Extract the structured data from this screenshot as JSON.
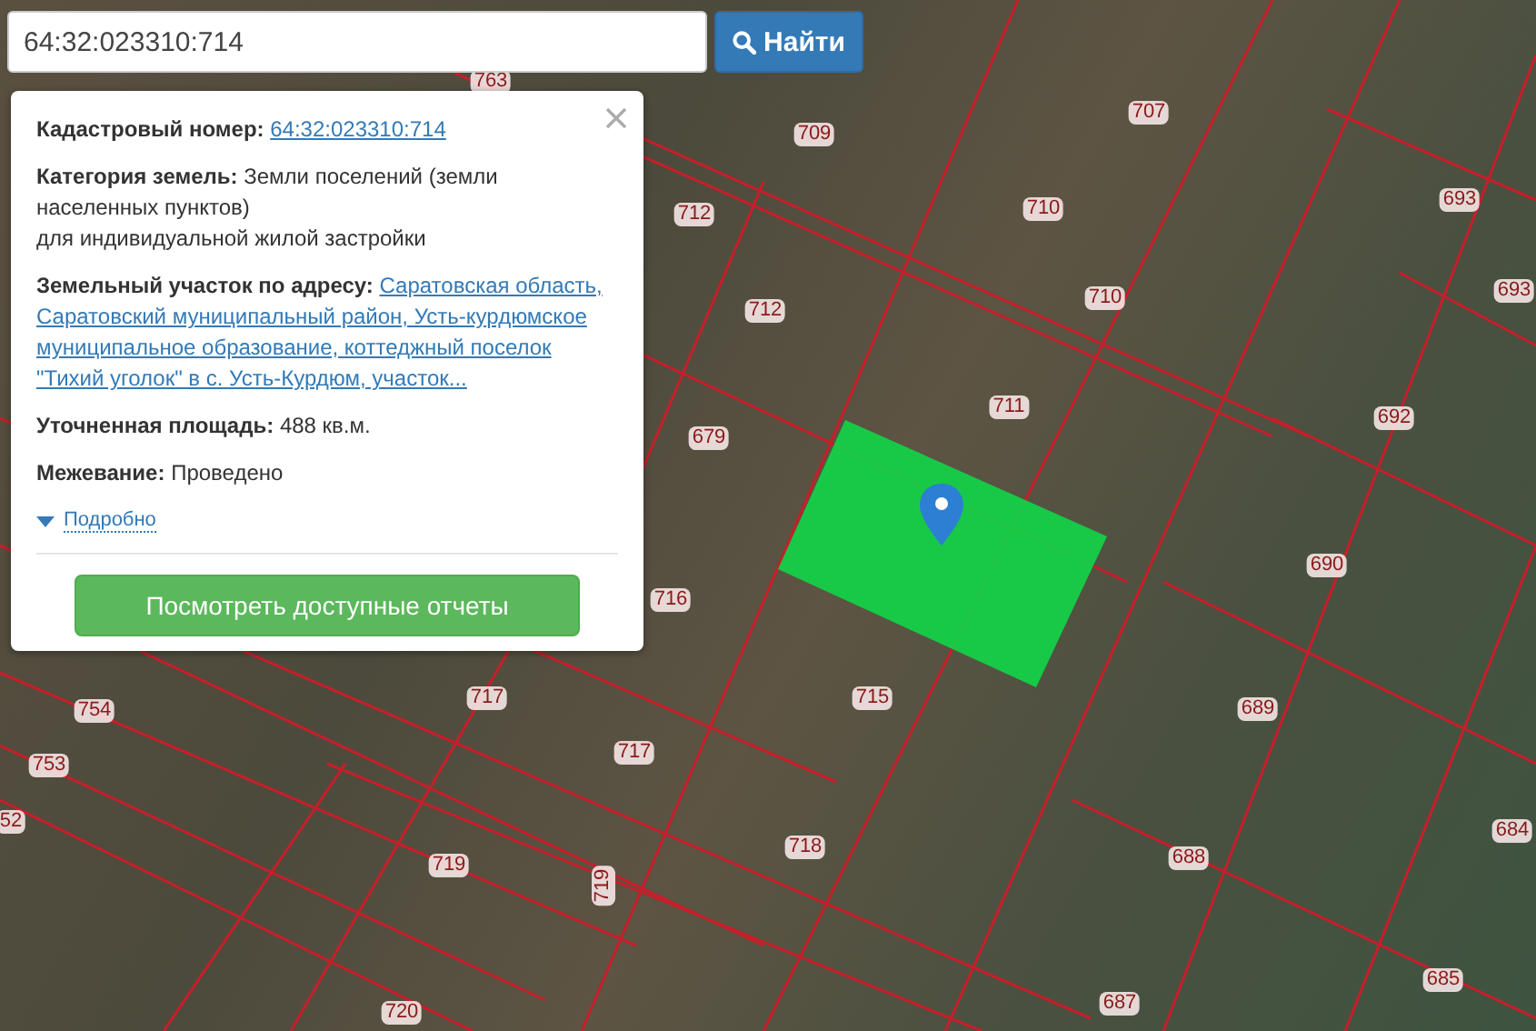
{
  "search": {
    "value": "64:32:023310:714",
    "button": "Найти"
  },
  "popup": {
    "rows": [
      {
        "label": "Кадастровый номер:",
        "value": "64:32:023310:714",
        "kind": "link"
      },
      {
        "label": "Категория земель:",
        "value": "Земли поселений (земли населенных пунктов)",
        "note": "для индивидуальной жилой застройки",
        "kind": "text"
      },
      {
        "label": "Земельный участок по адресу:",
        "value": "Саратовская область, Саратовский муниципальный район, Усть-курдюмское муниципальное образование, коттеджный поселок \"Тихий уголок\" в с. Усть-Курдюм, участок...",
        "kind": "link"
      },
      {
        "label": "Уточненная площадь:",
        "value": "488 кв.м.",
        "kind": "text"
      },
      {
        "label": "Межевание:",
        "value": "Проведено",
        "kind": "text"
      }
    ],
    "details": {
      "label": "Подробно",
      "expanded": false
    },
    "button": "Посмотреть доступные отчеты"
  },
  "map": {
    "parcel_labels": [
      "763",
      "709",
      "707",
      "712",
      "712",
      "710",
      "710",
      "693",
      "693",
      "711",
      "679",
      "692",
      "690",
      "716",
      "715",
      "689",
      "754",
      "753",
      "52",
      "717",
      "717",
      "718",
      "719",
      "719",
      "688",
      "684",
      "720",
      "687",
      "685"
    ]
  }
}
